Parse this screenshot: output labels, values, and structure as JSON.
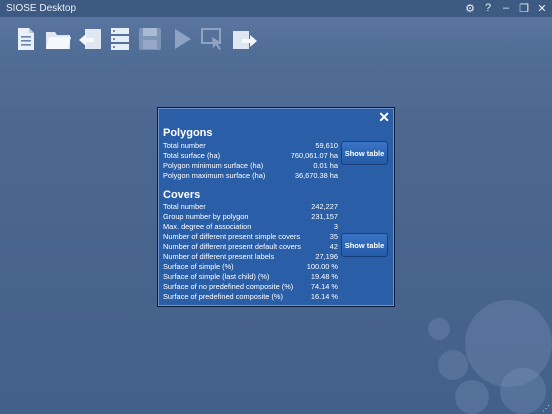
{
  "app": {
    "title": "SIOSE Desktop"
  },
  "window_controls": [
    "⚙",
    "?",
    "–",
    "❐",
    "✕"
  ],
  "toolbar": {
    "items": [
      "new-document-icon",
      "open-folder-icon",
      "import-icon",
      "server-icon",
      "save-icon",
      "run-icon",
      "select-area-icon",
      "export-icon"
    ]
  },
  "dialog": {
    "close": "✕",
    "polygons": {
      "title": "Polygons",
      "button": "Show table",
      "rows": [
        {
          "label": "Total number",
          "value": "59,610"
        },
        {
          "label": "Total surface (ha)",
          "value": "760,061.07 ha"
        },
        {
          "label": "Polygon minimum surface (ha)",
          "value": "0.01 ha"
        },
        {
          "label": "Polygon maximum surface (ha)",
          "value": "36,670.38 ha"
        }
      ]
    },
    "covers": {
      "title": "Covers",
      "button": "Show table",
      "rows": [
        {
          "label": "Total number",
          "value": "242,227"
        },
        {
          "label": "Group number by polygon",
          "value": "231,157"
        },
        {
          "label": "Max. degree of association",
          "value": "3"
        },
        {
          "label": "Number of different present simple covers",
          "value": "35"
        },
        {
          "label": "Number of different present default covers",
          "value": "42"
        },
        {
          "label": "Number of different present labels",
          "value": "27,196"
        },
        {
          "label": "Surface of simple (%)",
          "value": "100.00 %"
        },
        {
          "label": "Surface of simple (last child) (%)",
          "value": "19.48 %"
        },
        {
          "label": "Surface of no predefined composite (%)",
          "value": "74.14 %"
        },
        {
          "label": "Surface of predefined composite (%)",
          "value": "16.14 %"
        }
      ]
    }
  }
}
